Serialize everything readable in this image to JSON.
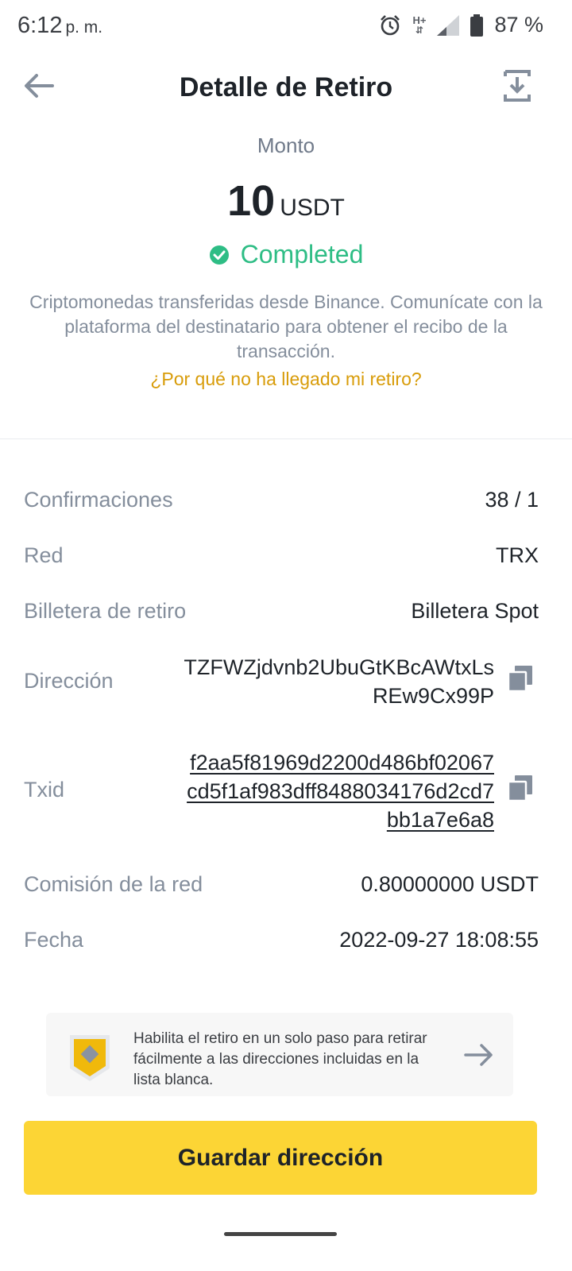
{
  "status_bar": {
    "time": "6:12",
    "ampm": "p. m.",
    "network": "H+",
    "battery": "87 %"
  },
  "header": {
    "title": "Detalle de Retiro"
  },
  "amount": {
    "label": "Monto",
    "value": "10",
    "unit": "USDT"
  },
  "status": {
    "text": "Completed",
    "color": "#2ebd85"
  },
  "description": "Criptomonedas transferidas desde Binance. Comunícate con la plataforma del destinatario para obtener el recibo de la transacción.",
  "help_link": "¿Por qué no ha llegado mi retiro?",
  "details": {
    "confirmations": {
      "label": "Confirmaciones",
      "value": "38 / 1"
    },
    "network": {
      "label": "Red",
      "value": "TRX"
    },
    "wallet": {
      "label": "Billetera de retiro",
      "value": "Billetera Spot"
    },
    "address": {
      "label": "Dirección",
      "line1": "TZFWZjdvnb2UbuGtKBcAWtxLs",
      "line2": "REw9Cx99P"
    },
    "txid": {
      "label": "Txid",
      "line1": "f2aa5f81969d2200d486bf02067",
      "line2": "cd5f1af983dff8488034176d2cd7",
      "line3": "bb1a7e6a8"
    },
    "fee": {
      "label": "Comisión de la red",
      "value": "0.80000000 USDT"
    },
    "date": {
      "label": "Fecha",
      "value": "2022-09-27 18:08:55"
    }
  },
  "banner": {
    "text": "Habilita el retiro en un solo paso para retirar fácilmente a las direcciones incluidas en la lista blanca."
  },
  "button": {
    "label": "Guardar dirección"
  },
  "colors": {
    "accent": "#fcd535",
    "link": "#d89c09",
    "success": "#2ebd85"
  },
  "icons": [
    "alarm-icon",
    "signal-icon",
    "battery-icon",
    "back-arrow-icon",
    "download-icon",
    "check-circle-icon",
    "copy-icon",
    "shield-icon",
    "arrow-right-icon"
  ]
}
